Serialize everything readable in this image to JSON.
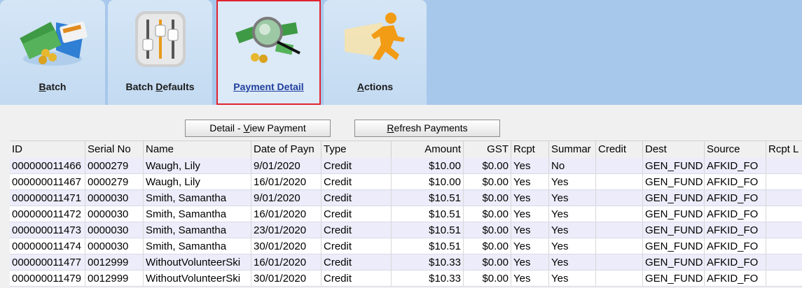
{
  "tabs": [
    {
      "pre": "",
      "u": "B",
      "post": "atch",
      "icon": "batch-icon"
    },
    {
      "pre": "Batch ",
      "u": "D",
      "post": "efaults",
      "icon": "sliders-icon"
    },
    {
      "pre": "",
      "u": "P",
      "post": "ayment Detail",
      "icon": "magnifier-money-icon"
    },
    {
      "pre": "",
      "u": "A",
      "post": "ctions",
      "icon": "running-man-icon"
    }
  ],
  "buttons": {
    "detail": {
      "pre": "Detail - ",
      "u": "V",
      "post": "iew Payment"
    },
    "refresh": {
      "pre": "",
      "u": "R",
      "post": "efresh Payments"
    }
  },
  "grid": {
    "columns": [
      "ID",
      "Serial No",
      "Name",
      "Date of Payn",
      "Type",
      "Amount",
      "GST",
      "Rcpt",
      "Summar",
      "Credit",
      "Dest",
      "Source",
      "Rcpt L"
    ],
    "rows": [
      [
        "000000011466",
        "0000279",
        "Waugh, Lily",
        "9/01/2020",
        "Credit",
        "$10.00",
        "$0.00",
        "Yes",
        "No",
        "",
        "GEN_FUND",
        "AFKID_FO",
        ""
      ],
      [
        "000000011467",
        "0000279",
        "Waugh, Lily",
        "16/01/2020",
        "Credit",
        "$10.00",
        "$0.00",
        "Yes",
        "Yes",
        "",
        "GEN_FUND",
        "AFKID_FO",
        ""
      ],
      [
        "000000011471",
        "0000030",
        "Smith, Samantha",
        "9/01/2020",
        "Credit",
        "$10.51",
        "$0.00",
        "Yes",
        "Yes",
        "",
        "GEN_FUND",
        "AFKID_FO",
        ""
      ],
      [
        "000000011472",
        "0000030",
        "Smith, Samantha",
        "16/01/2020",
        "Credit",
        "$10.51",
        "$0.00",
        "Yes",
        "Yes",
        "",
        "GEN_FUND",
        "AFKID_FO",
        ""
      ],
      [
        "000000011473",
        "0000030",
        "Smith, Samantha",
        "23/01/2020",
        "Credit",
        "$10.51",
        "$0.00",
        "Yes",
        "Yes",
        "",
        "GEN_FUND",
        "AFKID_FO",
        ""
      ],
      [
        "000000011474",
        "0000030",
        "Smith, Samantha",
        "30/01/2020",
        "Credit",
        "$10.51",
        "$0.00",
        "Yes",
        "Yes",
        "",
        "GEN_FUND",
        "AFKID_FO",
        ""
      ],
      [
        "000000011477",
        "0012999",
        "WithoutVolunteerSki",
        "16/01/2020",
        "Credit",
        "$10.33",
        "$0.00",
        "Yes",
        "Yes",
        "",
        "GEN_FUND",
        "AFKID_FO",
        ""
      ],
      [
        "000000011479",
        "0012999",
        "WithoutVolunteerSki",
        "30/01/2020",
        "Credit",
        "$10.33",
        "$0.00",
        "Yes",
        "Yes",
        "",
        "GEN_FUND",
        "AFKID_FO",
        ""
      ]
    ]
  }
}
